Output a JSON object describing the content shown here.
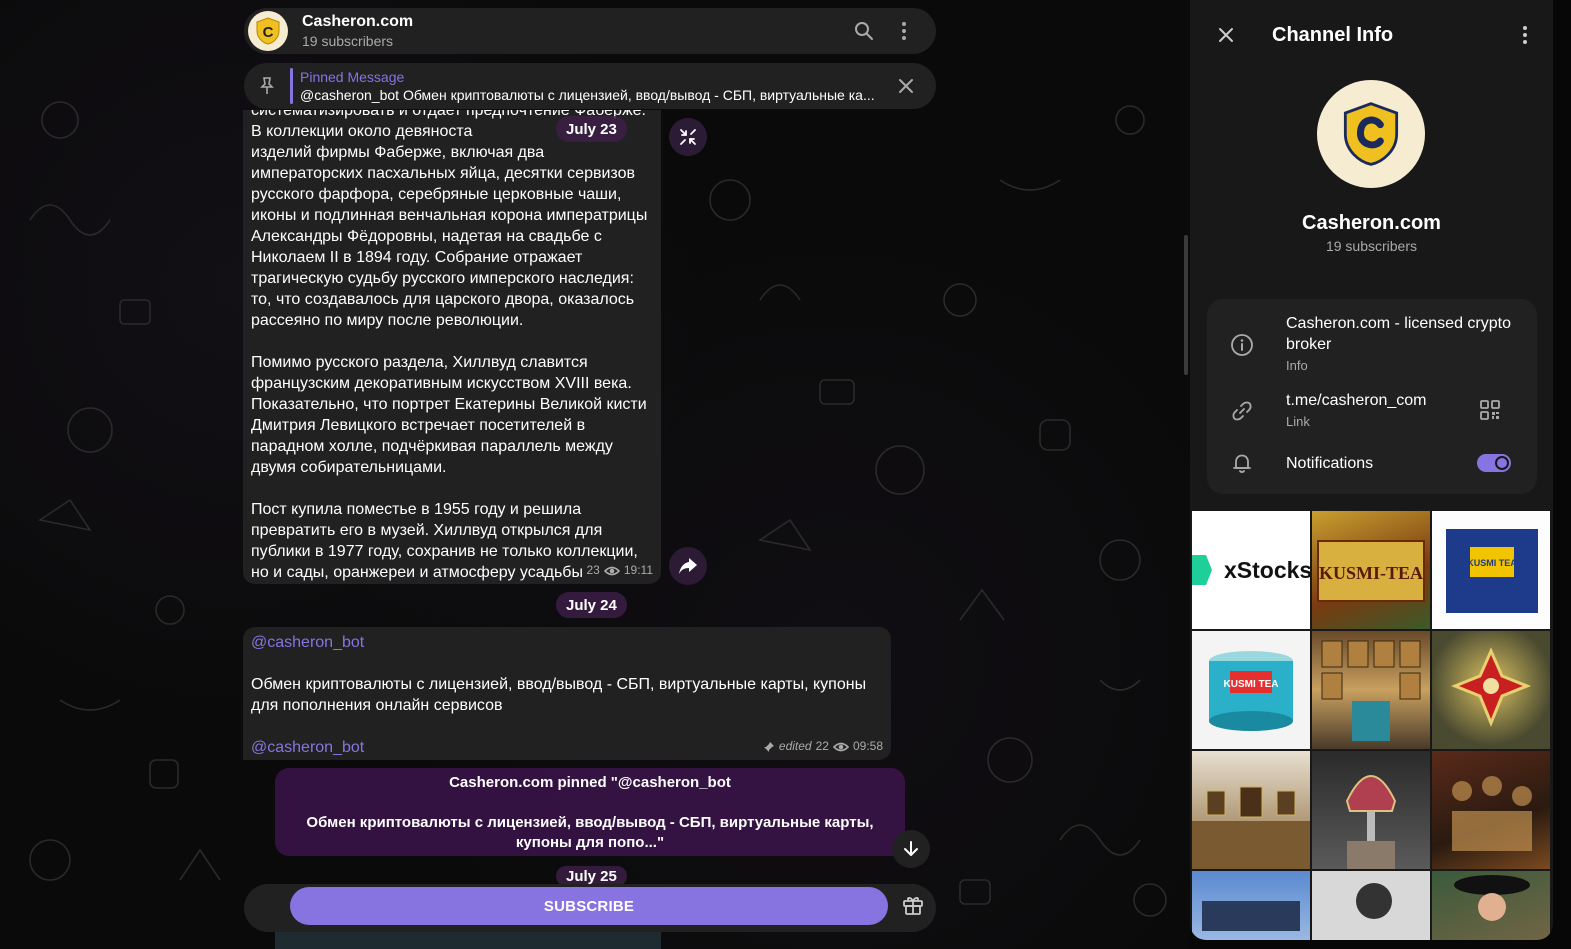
{
  "chat": {
    "header": {
      "title": "Casheron.com",
      "subtitle": "19 subscribers",
      "avatar_letter": "C"
    },
    "pinned": {
      "title": "Pinned Message",
      "text": "@casheron_bot Обмен криптовалюты с лицензией, ввод/вывод - СБП, виртуальные ка..."
    },
    "message1": {
      "top_clip": "систематизировать и отдает предпочтение Фаберже. В коллекции около девяноста",
      "line_a": "изделий фирмы Фаберже, включая два",
      "para1": "императорских пасхальных яйца, десятки сервизов русского фарфора, серебряные церковные чаши, иконы и подлинная венчальная корона императрицы Александры Фёдоровны, надетая на свадьбе с Николаем II в 1894 году. Собрание отражает трагическую судьбу русского имперского наследия: то, что создавалось для царского двора, оказалось рассеяно по миру после революции.",
      "para2": "Помимо русского раздела, Хиллвуд славится французским декоративным искусством XVIII века. Показательно, что портрет Екатерины Великой кисти Дмитрия Левицкого встречает посетителей в парадном холле, подчёркивая параллель между двумя собирательницами.",
      "para3": "Пост купила поместье в 1955 году и решила превратить его в музей. Хиллвуд открылся для публики в 1977 году, сохранив не только коллекции, но и сады, оранжереи и атмосферу усадьбы ушедшей эпохи.",
      "views": "23",
      "time": "19:11"
    },
    "dates": {
      "d1": "July 23",
      "d2": "July 24",
      "d3": "July 25"
    },
    "message2": {
      "link1": "@casheron_bot",
      "body": "Обмен криптовалюты с лицензией, ввод/вывод - СБП, виртуальные карты, купоны для пополнения онлайн сервисов",
      "link2": "@casheron_bot",
      "edited": "edited",
      "views": "22",
      "time": "09:58"
    },
    "service": {
      "line1": "Casheron.com pinned \"@casheron_bot",
      "line2": "Обмен криптовалюты с лицензией, ввод/вывод - СБП, виртуальные карты, купоны для попо...\""
    },
    "subscribe_label": "SUBSCRIBE"
  },
  "panel": {
    "title": "Channel Info",
    "name": "Casheron.com",
    "subscribers": "19 subscribers",
    "info": {
      "description": "Casheron.com - licensed crypto broker",
      "description_label": "Info",
      "link": "t.me/casheron_com",
      "link_label": "Link",
      "notifications_label": "Notifications",
      "notifications_on": true
    },
    "media": {
      "tile1_text": "xStocks",
      "tile2_text": "KUSMI-TEA",
      "tile3_text": "KUSMI TEA",
      "tile4_text": "KUSMI TEA"
    }
  },
  "colors": {
    "accent": "#8774e1",
    "surface": "#212121",
    "panel": "#181818",
    "date_chip": "#3c1e46"
  }
}
